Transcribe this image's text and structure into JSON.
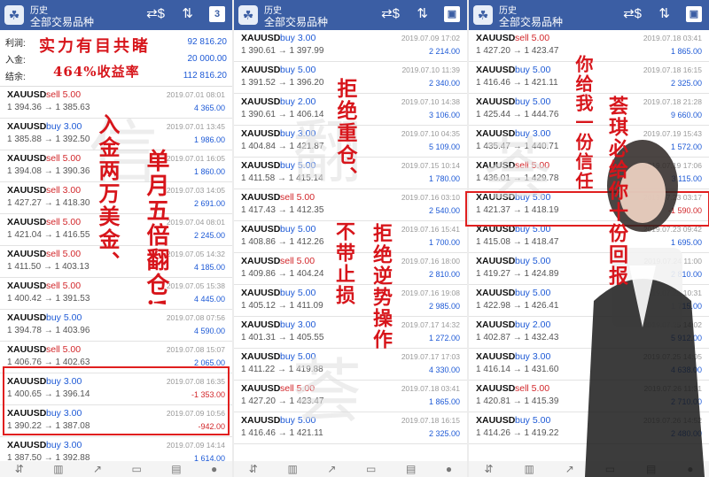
{
  "header": {
    "history": "历史",
    "all_symbols": "全部交易品种"
  },
  "summary": {
    "profit_label": "利润:",
    "profit_value": "92 816.20",
    "deposit_label": "入金:",
    "deposit_value": "20 000.00",
    "balance_label": "结余:",
    "balance_value": "112 816.20"
  },
  "panel1": [
    {
      "symbol": "XAUUSD",
      "side": "sell 5.00",
      "prices": "1 394.36 → 1 385.63",
      "time": "2019.07.01 08:01",
      "pnl": "4 365.00"
    },
    {
      "symbol": "XAUUSD",
      "side": "buy 3.00",
      "prices": "1 385.88 → 1 392.50",
      "time": "2019.07.01 13:45",
      "pnl": "1 986.00"
    },
    {
      "symbol": "XAUUSD",
      "side": "sell 5.00",
      "prices": "1 394.08 → 1 390.36",
      "time": "2019.07.01 16:05",
      "pnl": "1 860.00"
    },
    {
      "symbol": "XAUUSD",
      "side": "sell 3.00",
      "prices": "1 427.27 → 1 418.30",
      "time": "2019.07.03 14:05",
      "pnl": "2 691.00"
    },
    {
      "symbol": "XAUUSD",
      "side": "sell 5.00",
      "prices": "1 421.04 → 1 416.55",
      "time": "2019.07.04 08:01",
      "pnl": "2 245.00"
    },
    {
      "symbol": "XAUUSD",
      "side": "sell 5.00",
      "prices": "1 411.50 → 1 403.13",
      "time": "2019.07.05 14:32",
      "pnl": "4 185.00"
    },
    {
      "symbol": "XAUUSD",
      "side": "sell 5.00",
      "prices": "1 400.42 → 1 391.53",
      "time": "2019.07.05 15:38",
      "pnl": "4 445.00"
    },
    {
      "symbol": "XAUUSD",
      "side": "buy 5.00",
      "prices": "1 394.78 → 1 403.96",
      "time": "2019.07.08 07:56",
      "pnl": "4 590.00"
    },
    {
      "symbol": "XAUUSD",
      "side": "sell 5.00",
      "prices": "1 406.76 → 1 402.63",
      "time": "2019.07.08 15:07",
      "pnl": "2 065.00"
    },
    {
      "symbol": "XAUUSD",
      "side": "buy 3.00",
      "prices": "1 400.65 → 1 396.14",
      "time": "2019.07.08 16:35",
      "pnl": "-1 353.00"
    },
    {
      "symbol": "XAUUSD",
      "side": "buy 3.00",
      "prices": "1 390.22 → 1 387.08",
      "time": "2019.07.09 10:56",
      "pnl": "-942.00"
    },
    {
      "symbol": "XAUUSD",
      "side": "buy 3.00",
      "prices": "1 387.50 → 1 392.88",
      "time": "2019.07.09 14:14",
      "pnl": "1 614.00"
    }
  ],
  "panel2": [
    {
      "symbol": "XAUUSD",
      "side": "buy 3.00",
      "prices": "1 390.61 → 1 397.99",
      "time": "2019.07.09 17:02",
      "pnl": "2 214.00"
    },
    {
      "symbol": "XAUUSD",
      "side": "buy 5.00",
      "prices": "1 391.52 → 1 396.20",
      "time": "2019.07.10 11:39",
      "pnl": "2 340.00"
    },
    {
      "symbol": "XAUUSD",
      "side": "buy 2.00",
      "prices": "1 390.61 → 1 406.14",
      "time": "2019.07.10 14:38",
      "pnl": "3 106.00"
    },
    {
      "symbol": "XAUUSD",
      "side": "buy 3.00",
      "prices": "1 404.84 → 1 421.87",
      "time": "2019.07.10 04:35",
      "pnl": "5 109.00"
    },
    {
      "symbol": "XAUUSD",
      "side": "buy 5.00",
      "prices": "1 411.58 → 1 415.14",
      "time": "2019.07.15 10:14",
      "pnl": "1 780.00"
    },
    {
      "symbol": "XAUUSD",
      "side": "sell 5.00",
      "prices": "1 417.43 → 1 412.35",
      "time": "2019.07.16 03:10",
      "pnl": "2 540.00"
    },
    {
      "symbol": "XAUUSD",
      "side": "buy 5.00",
      "prices": "1 408.86 → 1 412.26",
      "time": "2019.07.16 15:41",
      "pnl": "1 700.00"
    },
    {
      "symbol": "XAUUSD",
      "side": "sell 5.00",
      "prices": "1 409.86 → 1 404.24",
      "time": "2019.07.16 18:00",
      "pnl": "2 810.00"
    },
    {
      "symbol": "XAUUSD",
      "side": "buy 5.00",
      "prices": "1 405.12 → 1 411.09",
      "time": "2019.07.16 19:08",
      "pnl": "2 985.00"
    },
    {
      "symbol": "XAUUSD",
      "side": "buy 3.00",
      "prices": "1 401.31 → 1 405.55",
      "time": "2019.07.17 14:32",
      "pnl": "1 272.00"
    },
    {
      "symbol": "XAUUSD",
      "side": "buy 5.00",
      "prices": "1 411.22 → 1 419.88",
      "time": "2019.07.17 17:03",
      "pnl": "4 330.00"
    },
    {
      "symbol": "XAUUSD",
      "side": "sell 5.00",
      "prices": "1 427.20 → 1 423.47",
      "time": "2019.07.18 03:41",
      "pnl": "1 865.00"
    },
    {
      "symbol": "XAUUSD",
      "side": "buy 5.00",
      "prices": "1 416.46 → 1 421.11",
      "time": "2019.07.18 16:15",
      "pnl": "2 325.00"
    }
  ],
  "panel3": [
    {
      "symbol": "XAUUSD",
      "side": "sell 5.00",
      "prices": "1 427.20 → 1 423.47",
      "time": "2019.07.18 03:41",
      "pnl": "1 865.00"
    },
    {
      "symbol": "XAUUSD",
      "side": "buy 5.00",
      "prices": "1 416.46 → 1 421.11",
      "time": "2019.07.18 16:15",
      "pnl": "2 325.00"
    },
    {
      "symbol": "XAUUSD",
      "side": "buy 5.00",
      "prices": "1 425.44 → 1 444.76",
      "time": "2019.07.18 21:28",
      "pnl": "9 660.00"
    },
    {
      "symbol": "XAUUSD",
      "side": "buy 3.00",
      "prices": "1 435.47 → 1 440.71",
      "time": "2019.07.19 15:43",
      "pnl": "1 572.00"
    },
    {
      "symbol": "XAUUSD",
      "side": "sell 5.00",
      "prices": "1 436.01 → 1 429.78",
      "time": "2019.07.19 17:06",
      "pnl": "3 115.00"
    },
    {
      "symbol": "XAUUSD",
      "side": "buy 5.00",
      "prices": "1 421.37 → 1 418.19",
      "time": "2019.07.23 03:17",
      "pnl": "-1 590.00"
    },
    {
      "symbol": "XAUUSD",
      "side": "buy 5.00",
      "prices": "1 415.08 → 1 418.47",
      "time": "2019.07.23 09:42",
      "pnl": "1 695.00"
    },
    {
      "symbol": "XAUUSD",
      "side": "buy 5.00",
      "prices": "1 419.27 → 1 424.89",
      "time": "2019.07.24 11:00",
      "pnl": "2 810.00"
    },
    {
      "symbol": "XAUUSD",
      "side": "buy 5.00",
      "prices": "1 422.98 → 1 426.41",
      "time": "2019.07.25 10:31",
      "pnl": "1 715.00"
    },
    {
      "symbol": "XAUUSD",
      "side": "buy 2.00",
      "prices": "1 402.87 → 1 432.43",
      "time": "2019.07.25 14:02",
      "pnl": "5 912.00"
    },
    {
      "symbol": "XAUUSD",
      "side": "buy 3.00",
      "prices": "1 416.14 → 1 431.60",
      "time": "2019.07.25 14:05",
      "pnl": "4 638.00"
    },
    {
      "symbol": "XAUUSD",
      "side": "sell 5.00",
      "prices": "1 420.81 → 1 415.39",
      "time": "2019.07.26 11:31",
      "pnl": "2 710.00"
    },
    {
      "symbol": "XAUUSD",
      "side": "buy 5.00",
      "prices": "1 414.26 → 1 419.22",
      "time": "2019.07.26 14:52",
      "pnl": "2 480.00"
    }
  ],
  "calligraphy": {
    "p1_top1": "实力有目共睹",
    "p1_top2": "464%收益率",
    "p1_col1": "入金两万美金、",
    "p1_col2": "单月五倍翻仓!",
    "p2_col1": "拒绝重仓、",
    "p2_col2": "不带止损",
    "p2_col3": "拒绝逆势操作",
    "p3_col1": "你给我一份信任",
    "p3_col2": "荟琪必给你十份回报"
  },
  "watermark": {
    "w1": "信",
    "w2": "翻",
    "w3": "荟"
  },
  "colors": {
    "header_bg": "#3b5ea4",
    "buy": "#1e5ad6",
    "sell": "#d2262a",
    "highlight": "#e01f1f",
    "calligraphy": "#d7151b"
  }
}
